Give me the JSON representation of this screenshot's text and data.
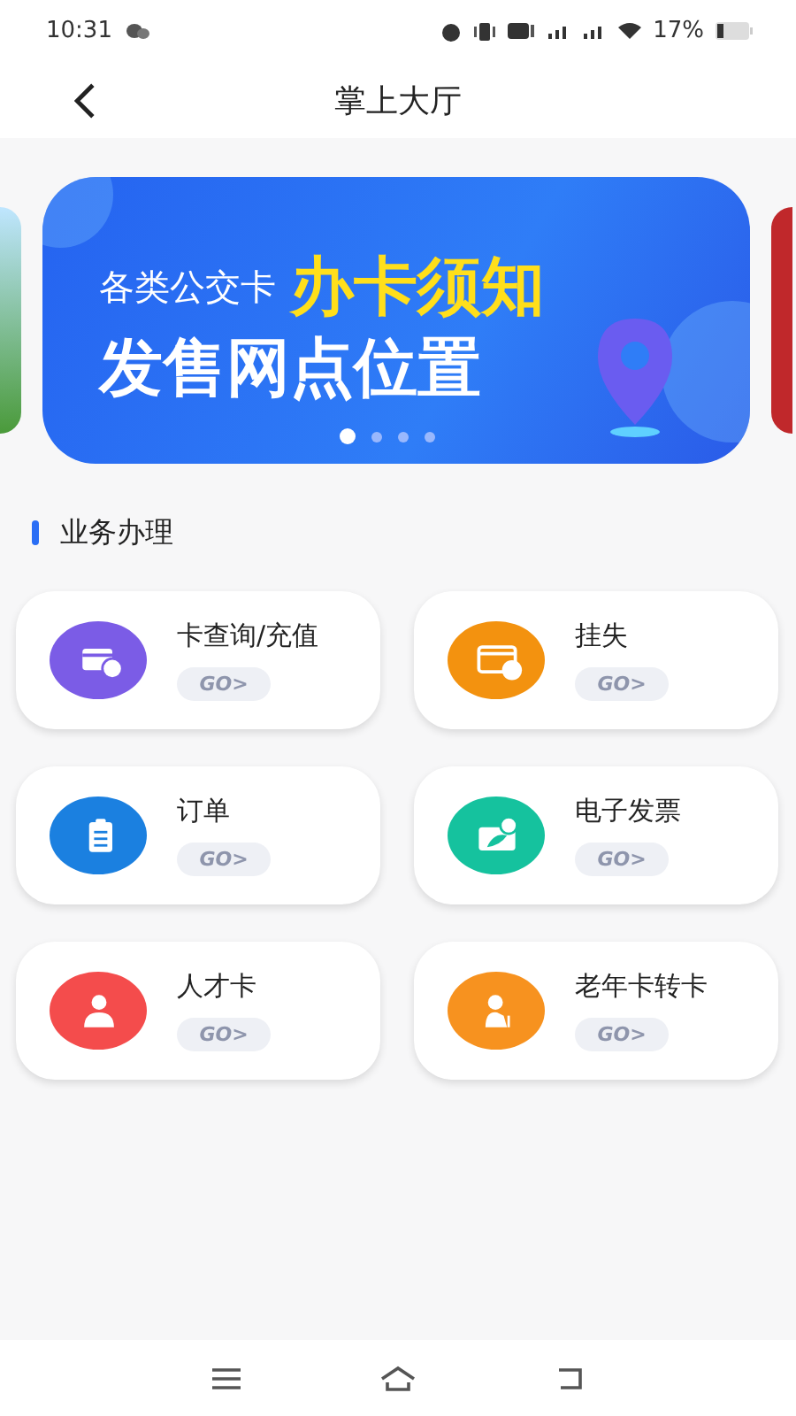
{
  "status_bar": {
    "time": "10:31",
    "battery": "17%"
  },
  "header": {
    "title": "掌上大厅"
  },
  "banner": {
    "line_1_small": "各类公交卡",
    "line_1_big": "办卡须知",
    "line_2": "发售网点位置",
    "dots": [
      {
        "selected": true
      },
      {
        "selected": false
      },
      {
        "selected": false
      },
      {
        "selected": false
      }
    ]
  },
  "section": {
    "title": "业务办理"
  },
  "services": [
    {
      "label": "卡查询/充值",
      "go": "GO>",
      "kind": "card-yuan",
      "color": "#7b5ce6"
    },
    {
      "label": "挂失",
      "go": "GO>",
      "kind": "card-lock",
      "color": "#f3920f"
    },
    {
      "label": "订单",
      "go": "GO>",
      "kind": "clipboard",
      "color": "#1b80e0"
    },
    {
      "label": "电子发票",
      "go": "GO>",
      "kind": "invoice",
      "color": "#15c29e"
    },
    {
      "label": "人才卡",
      "go": "GO>",
      "kind": "person",
      "color": "#f44c4c"
    },
    {
      "label": "老年卡转卡",
      "go": "GO>",
      "kind": "elder",
      "color": "#f7921f"
    }
  ]
}
